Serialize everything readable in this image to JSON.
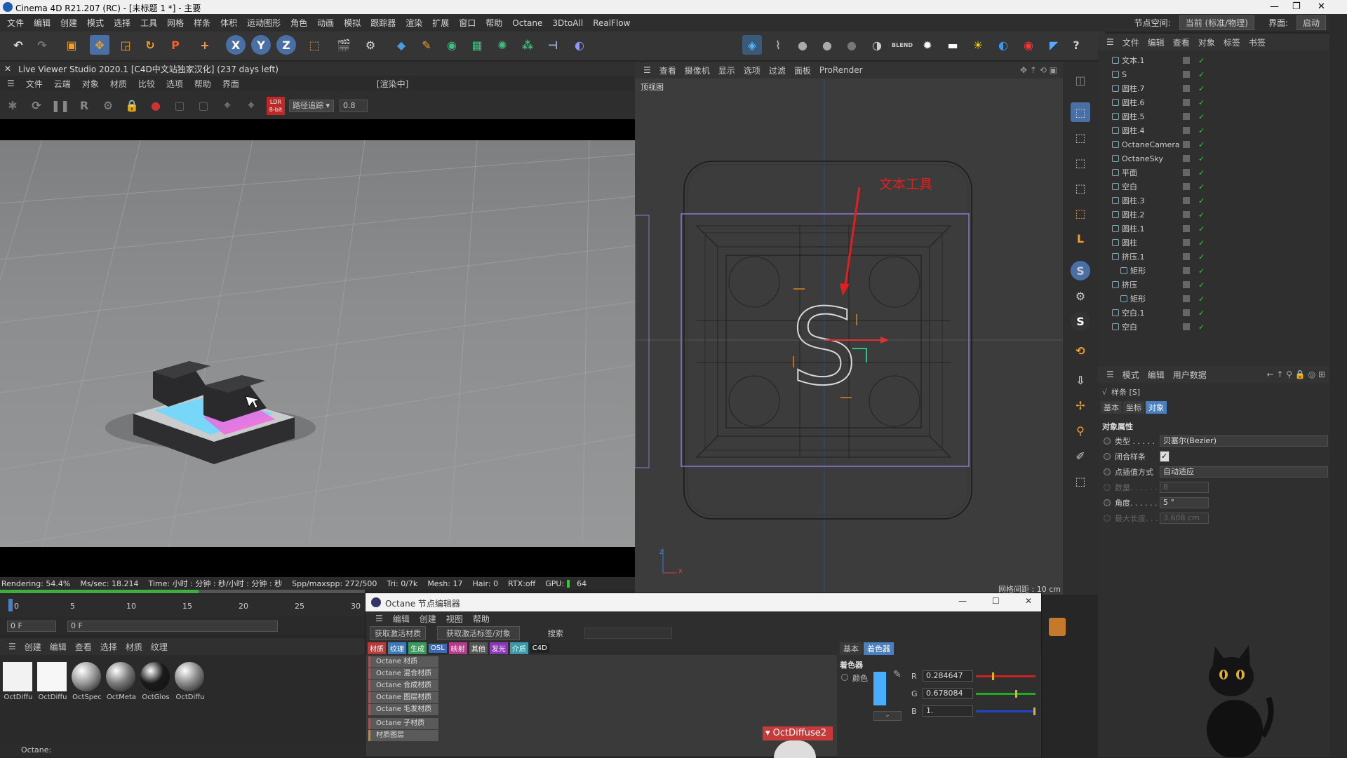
{
  "window": {
    "title": "Cinema 4D R21.207 (RC) - [未标题 1 *] - 主要",
    "controls": [
      "—",
      "❐",
      "✕"
    ]
  },
  "menubar": {
    "items": [
      "文件",
      "编辑",
      "创建",
      "模式",
      "选择",
      "工具",
      "网格",
      "样条",
      "体积",
      "运动图形",
      "角色",
      "动画",
      "模拟",
      "跟踪器",
      "渲染",
      "扩展",
      "窗口",
      "帮助",
      "Octane",
      "3DtoAll",
      "RealFlow"
    ],
    "node_space_label": "节点空间:",
    "node_space_value": "当前 (标准/物理)",
    "layout_label": "界面:",
    "layout_value": "启动"
  },
  "live_viewer": {
    "title": "Live Viewer Studio 2020.1 [C4D中文站独家汉化] (237 days left)",
    "menu": [
      "文件",
      "云端",
      "对象",
      "材质",
      "比较",
      "选项",
      "帮助",
      "界面"
    ],
    "state": "[渲染中]",
    "ldr": "LDR",
    "ldr_sub": "8-bit",
    "mode": "路径追踪",
    "value": "0.8",
    "status": {
      "rendering": "Rendering: 54.4%",
      "ms_sec": "Ms/sec: 18.214",
      "time": "Time: 小时 : 分钟 : 秒/小时 : 分钟 : 秒",
      "spp": "Spp/maxspp: 272/500",
      "tri": "Tri: 0/7k",
      "mesh": "Mesh: 17",
      "hair": "Hair: 0",
      "rtx": "RTX:off",
      "gpu": "GPU:",
      "gpu_val": "64"
    },
    "progress": 0.544
  },
  "viewport": {
    "menu": [
      "查看",
      "摄像机",
      "显示",
      "选项",
      "过滤",
      "面板",
      "ProRender"
    ],
    "view_name": "顶视图",
    "annotation": "文本工具",
    "letter": "S",
    "grid_info": "网格间距 : 10 cm",
    "axis_z": "z",
    "axis_x": "x"
  },
  "object_manager": {
    "menu": [
      "文件",
      "编辑",
      "查看",
      "对象",
      "标签",
      "书签"
    ],
    "objects": [
      {
        "name": "文本.1",
        "indent": 0
      },
      {
        "name": "S",
        "indent": 0
      },
      {
        "name": "圆柱.7",
        "indent": 0
      },
      {
        "name": "圆柱.6",
        "indent": 0
      },
      {
        "name": "圆柱.5",
        "indent": 0
      },
      {
        "name": "圆柱.4",
        "indent": 0
      },
      {
        "name": "OctaneCamera",
        "indent": 0
      },
      {
        "name": "OctaneSky",
        "indent": 0
      },
      {
        "name": "平面",
        "indent": 0
      },
      {
        "name": "空白",
        "indent": 0
      },
      {
        "name": "圆柱.3",
        "indent": 0
      },
      {
        "name": "圆柱.2",
        "indent": 0
      },
      {
        "name": "圆柱.1",
        "indent": 0
      },
      {
        "name": "圆柱",
        "indent": 0
      },
      {
        "name": "挤压.1",
        "indent": 0
      },
      {
        "name": "矩形",
        "indent": 1
      },
      {
        "name": "挤压",
        "indent": 0
      },
      {
        "name": "矩形",
        "indent": 1
      },
      {
        "name": "空白.1",
        "indent": 0
      },
      {
        "name": "空白",
        "indent": 0
      }
    ]
  },
  "attributes": {
    "menu": [
      "模式",
      "编辑",
      "用户数据"
    ],
    "object_title": "样条 [S]",
    "tabs": [
      "基本",
      "坐标",
      "对象"
    ],
    "active_tab": "对象",
    "section": "对象属性",
    "fields": [
      {
        "label": "类型 . . . . .",
        "value": "贝塞尔(Bezier)",
        "enabled": true
      },
      {
        "label": "闭合样条",
        "value": "✓",
        "enabled": true
      },
      {
        "label": "点插值方式",
        "value": "自动适应",
        "enabled": true
      },
      {
        "label": "数量. . . . . .",
        "value": "8",
        "enabled": false
      },
      {
        "label": "角度. . . . . .",
        "value": "5 °",
        "enabled": true
      },
      {
        "label": "最大长度. . .",
        "value": "3.608 cm",
        "enabled": false
      }
    ]
  },
  "timeline": {
    "ticks": [
      "0",
      "5",
      "10",
      "15",
      "20",
      "25",
      "30"
    ],
    "current_frame": "0 F",
    "frame_field": "0 F"
  },
  "material_manager": {
    "menu": [
      "创建",
      "编辑",
      "查看",
      "选择",
      "材质",
      "纹理"
    ],
    "materials": [
      {
        "name": "OctDiffu",
        "color": "#f2f2f2"
      },
      {
        "name": "OctDiffu",
        "color": "#f7f7f7"
      },
      {
        "name": "OctSpec",
        "color": "#9a9a9a"
      },
      {
        "name": "OctMeta",
        "color": "#7b7b7b"
      },
      {
        "name": "OctGlos",
        "color": "#1a1a1a"
      },
      {
        "name": "OctDiffu",
        "color": "#8a8a8a"
      }
    ]
  },
  "statusbar": {
    "text": "Octane:"
  },
  "node_editor": {
    "title": "Octane 节点编辑器",
    "menu": [
      "编辑",
      "创建",
      "视图",
      "帮助"
    ],
    "btn_get_material": "获取激活材质",
    "btn_get_tag": "获取激活标签/对象",
    "search_label": "搜索",
    "categories": [
      {
        "label": "材质",
        "color": "#b83a3a"
      },
      {
        "label": "纹理",
        "color": "#3a7ab8"
      },
      {
        "label": "生成",
        "color": "#3a9a5a"
      },
      {
        "label": "OSL",
        "color": "#3a6ab8"
      },
      {
        "label": "映射",
        "color": "#b83a8a"
      },
      {
        "label": "其他",
        "color": "#555555"
      },
      {
        "label": "发光",
        "color": "#8a3ab8"
      },
      {
        "label": "介质",
        "color": "#3a9aa8"
      },
      {
        "label": "C4D",
        "color": "#222222"
      }
    ],
    "items": [
      "Octane 材质",
      "Octane 混合材质",
      "Octane 合成材质",
      "Octane 图层材质",
      "Octane 毛发材质",
      "Octane 子材质",
      "材质图层"
    ],
    "node_name": "OctDiffuse2",
    "right_tabs": [
      "基本",
      "着色器"
    ],
    "section": "着色器",
    "color_label": "颜色",
    "r_label": "R",
    "g_label": "G",
    "b_label": "B",
    "r_value": "0.284647",
    "g_value": "0.678084",
    "b_value": "1.",
    "swatch": "#48acff"
  },
  "colors": {
    "accent": "#5b9bd5",
    "annotation_red": "#e02020",
    "tab_active": "#4a7fc1"
  }
}
